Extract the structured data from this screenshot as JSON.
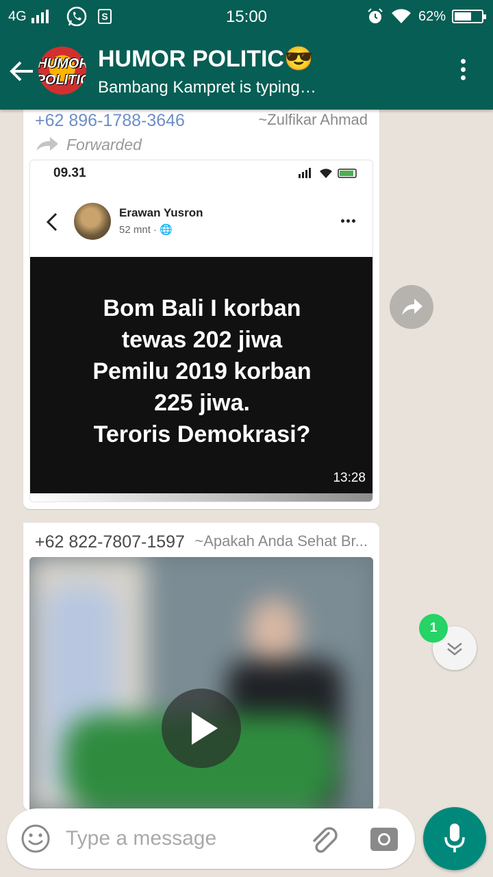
{
  "status_bar": {
    "network": "4G",
    "time": "15:00",
    "battery": "62%",
    "battery_level": 0.62
  },
  "header": {
    "title": "HUMOR POLITIC😎",
    "subtitle": "Bambang Kampret is typing…",
    "avatar_text_line1": "HUMOR",
    "avatar_text_line2": "POLITIC"
  },
  "messages": [
    {
      "sender": "+62 896-1788-3646",
      "alias": "~Zulfikar Ahmad",
      "forwarded_label": "Forwarded",
      "screenshot": {
        "phone_time": "09.31",
        "poster_name": "Erawan Yusron",
        "poster_meta": "52 mnt · 🌐",
        "post_lines": [
          "Bom Bali I korban",
          "tewas 202 jiwa",
          "Pemilu 2019 korban",
          "225 jiwa.",
          "Teroris Demokrasi?"
        ]
      },
      "timestamp": "13:28"
    },
    {
      "sender": "+62 822-7807-1597",
      "alias": "~Apakah Anda Sehat Br..."
    }
  ],
  "unread_count": "1",
  "composer": {
    "placeholder": "Type a message"
  },
  "colors": {
    "header": "#075e54",
    "accent": "#00897b",
    "badge": "#25d366"
  }
}
